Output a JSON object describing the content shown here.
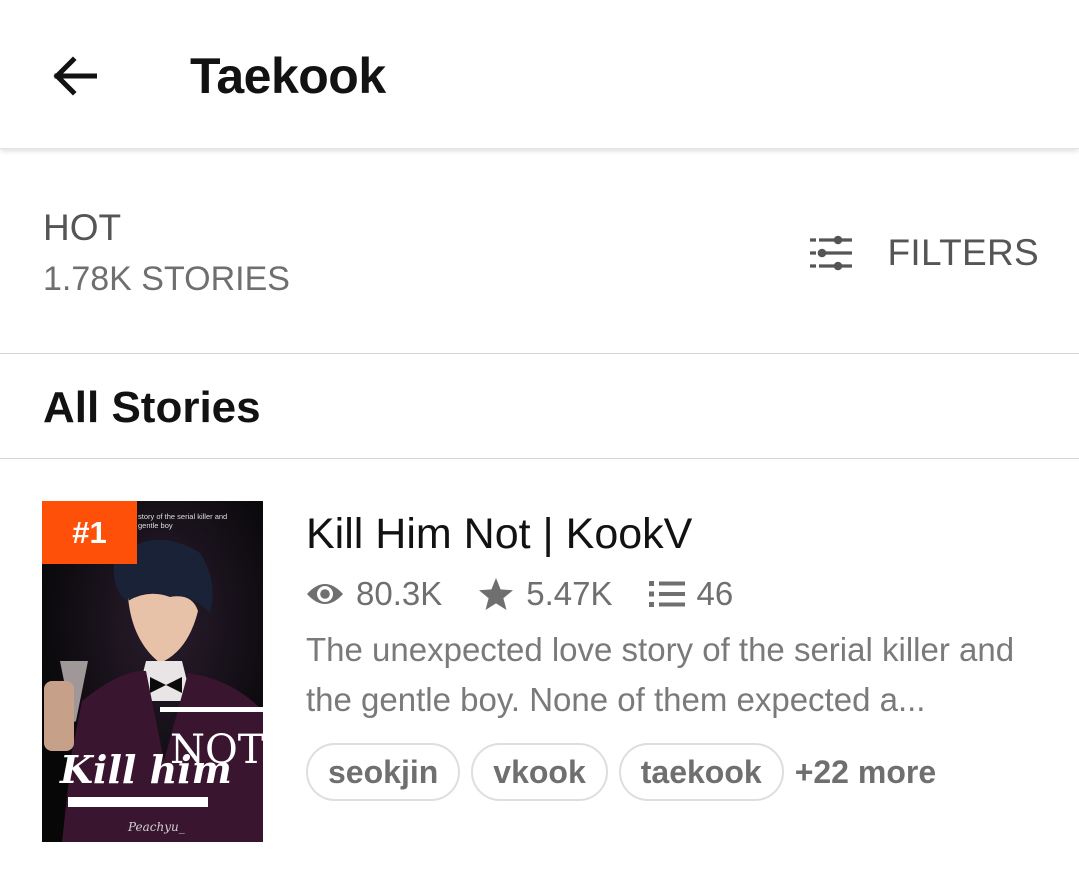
{
  "appbar": {
    "title": "Taekook",
    "back_icon": "arrow-left-icon"
  },
  "sort": {
    "label": "HOT",
    "count": "1.78K STORIES",
    "filters_label": "FILTERS",
    "filters_icon": "tune-sliders-icon"
  },
  "section": {
    "title": "All Stories"
  },
  "stories": [
    {
      "rank": "#1",
      "title": "Kill Him Not | KookV",
      "reads": "80.3K",
      "votes": "5.47K",
      "parts": "46",
      "description": "The unexpected love story of the serial killer and the gentle boy. None of them expected a...",
      "tags": [
        "seokjin",
        "vkook",
        "taekook"
      ],
      "more_tags": "+22 more",
      "cover": {
        "tagline": "story of the serial killer and gentle boy",
        "title_text": "Kill him NOT",
        "author": "Peachyu_"
      }
    }
  ],
  "colors": {
    "accent": "#ff500a",
    "text_primary": "#121212",
    "text_secondary": "#6f6f6f"
  }
}
